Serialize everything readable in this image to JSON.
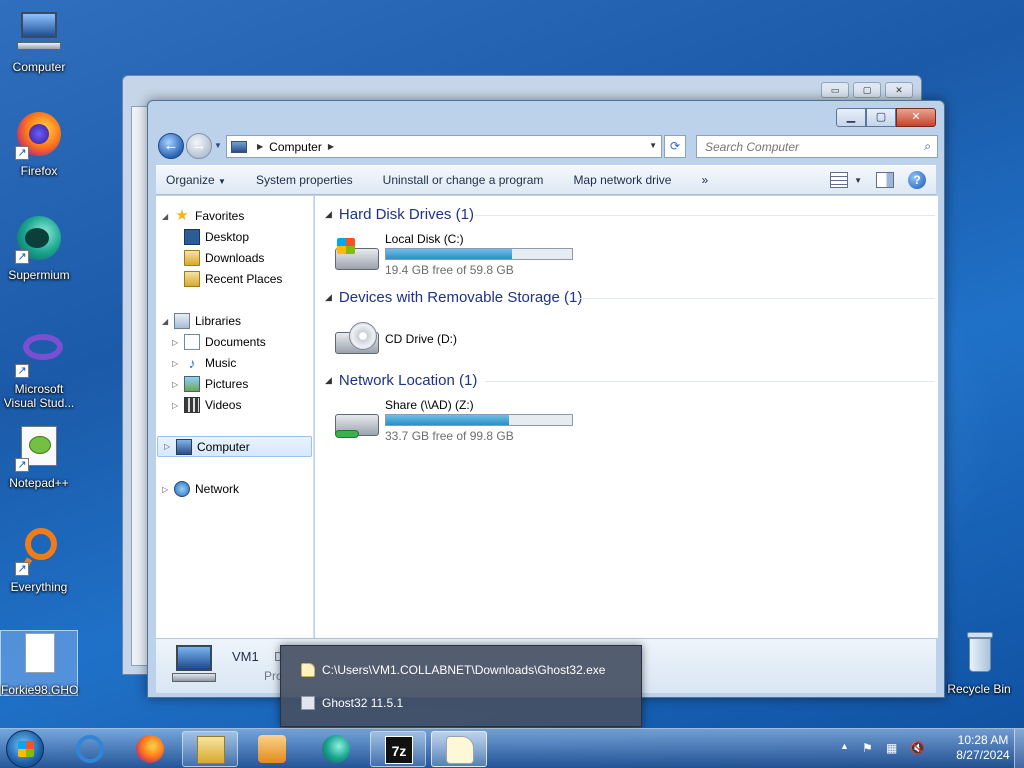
{
  "desktop": {
    "icons": [
      {
        "label": "Computer"
      },
      {
        "label": "Firefox"
      },
      {
        "label": "Supermium"
      },
      {
        "label": "Microsoft Visual Stud..."
      },
      {
        "label": "Notepad++"
      },
      {
        "label": "Everything"
      },
      {
        "label": "Forkie98.GHO"
      },
      {
        "label": "Recycle Bin"
      }
    ]
  },
  "window": {
    "address": {
      "crumb": "Computer"
    },
    "search": {
      "placeholder": "Search Computer"
    },
    "commands": [
      "Organize",
      "System properties",
      "Uninstall or change a program",
      "Map network drive"
    ],
    "more": "»"
  },
  "nav": {
    "favorites": {
      "label": "Favorites",
      "items": [
        "Desktop",
        "Downloads",
        "Recent Places"
      ]
    },
    "libraries": {
      "label": "Libraries",
      "items": [
        "Documents",
        "Music",
        "Pictures",
        "Videos"
      ]
    },
    "computer": "Computer",
    "network": "Network"
  },
  "groups": [
    {
      "title": "Hard Disk Drives (1)"
    },
    {
      "title": "Devices with Removable Storage (1)"
    },
    {
      "title": "Network Location (1)"
    }
  ],
  "drives": [
    {
      "name": "Local Disk (C:)",
      "free": "19.4 GB free of 59.8 GB",
      "used_fraction": 0.68
    },
    {
      "name": "CD Drive (D:)"
    },
    {
      "name": "Share (\\\\AD) (Z:)",
      "free": "33.7 GB free of 99.8 GB",
      "used_fraction": 0.66
    }
  ],
  "details": {
    "name": "VM1",
    "d_fragment": "D",
    "pro_fragment": "Pro"
  },
  "jumplist": {
    "items": [
      {
        "label": "C:\\Users\\VM1.COLLABNET\\Downloads\\Ghost32.exe"
      },
      {
        "label": "Ghost32 11.5.1"
      }
    ]
  },
  "taskbar": {
    "clock": {
      "time": "10:28 AM",
      "date": "8/27/2024"
    },
    "tray_chevron": "▲"
  }
}
